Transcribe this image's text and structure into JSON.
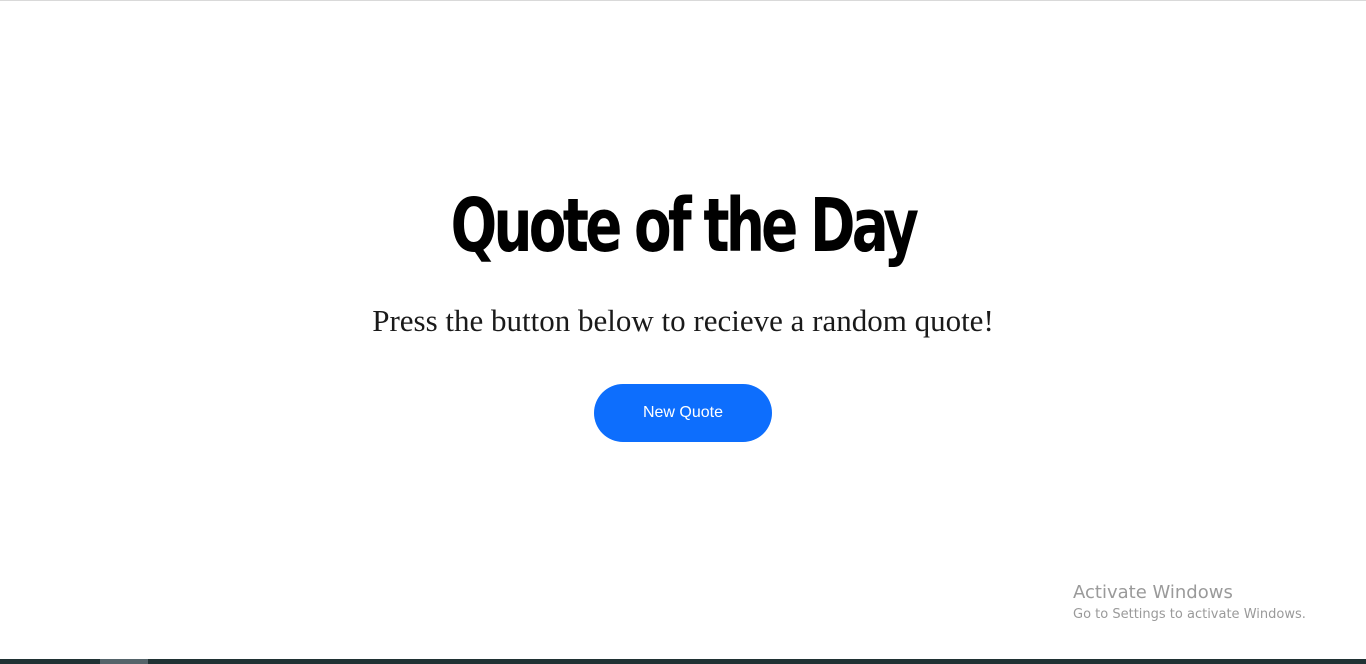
{
  "main": {
    "title": "Quote of the Day",
    "subtitle": "Press the button below to recieve a random quote!",
    "new_quote_label": "New Quote"
  },
  "watermark": {
    "title": "Activate Windows",
    "subtitle": "Go to Settings to activate Windows."
  },
  "colors": {
    "button": "#0d6efd",
    "button_text": "#ffffff",
    "background": "#ffffff",
    "title": "#000000",
    "taskbar": "#203234"
  }
}
